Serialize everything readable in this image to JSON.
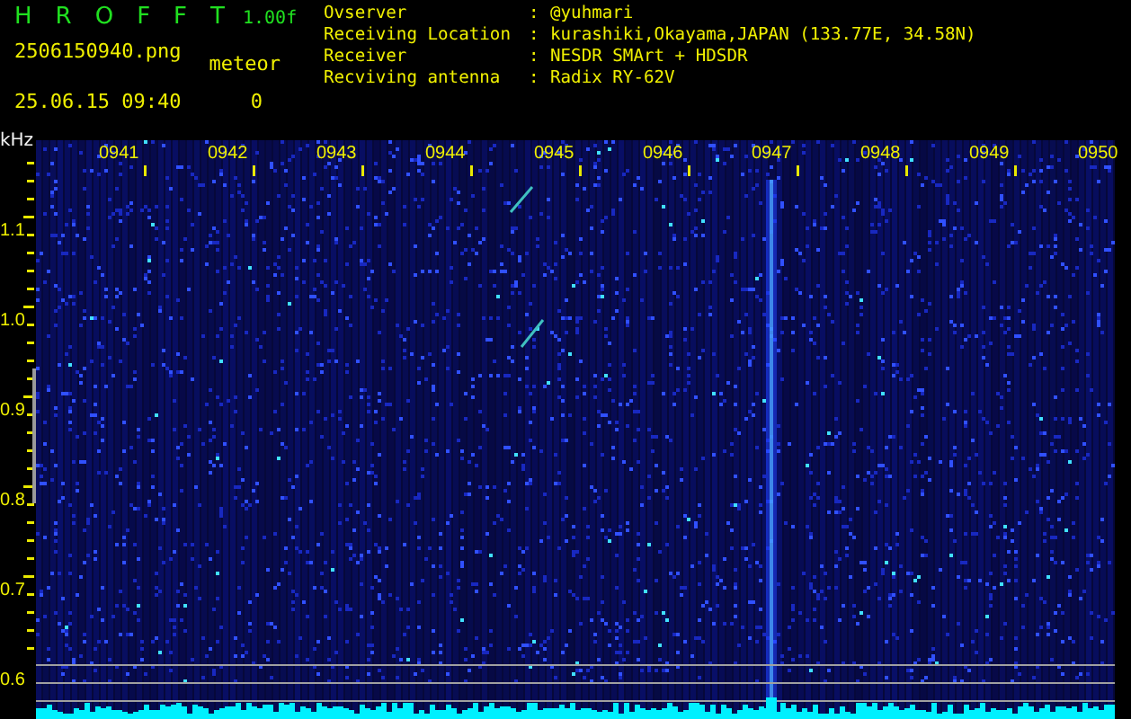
{
  "header": {
    "title_letters": [
      "H",
      "R",
      "O",
      "F",
      "F",
      "T"
    ],
    "version": "1.00f",
    "filename": "2506150940.png",
    "datetime": "25.06.15 09:40",
    "meteor_label": "meteor",
    "meteor_count": "0"
  },
  "info": [
    {
      "label": "Ovserver",
      "separator": ":",
      "value": "@yuhmari"
    },
    {
      "label": "Receiving Location",
      "separator": ":",
      "value": "kurashiki,Okayama,JAPAN (133.77E, 34.58N)"
    },
    {
      "label": "Receiver",
      "separator": ":",
      "value": "NESDR SMArt + HDSDR"
    },
    {
      "label": "Recviving antenna",
      "separator": ":",
      "value": "Radix RY-62V"
    }
  ],
  "spectrogram": {
    "unit": "kHz",
    "y_labels": [
      "1.1",
      "1.0",
      "0.9",
      "0.8",
      "0.7",
      "0.6"
    ],
    "time_labels": [
      "0941",
      "0942",
      "0943",
      "0944",
      "0945",
      "0946",
      "0947",
      "0948",
      "0949",
      "0950"
    ]
  }
}
